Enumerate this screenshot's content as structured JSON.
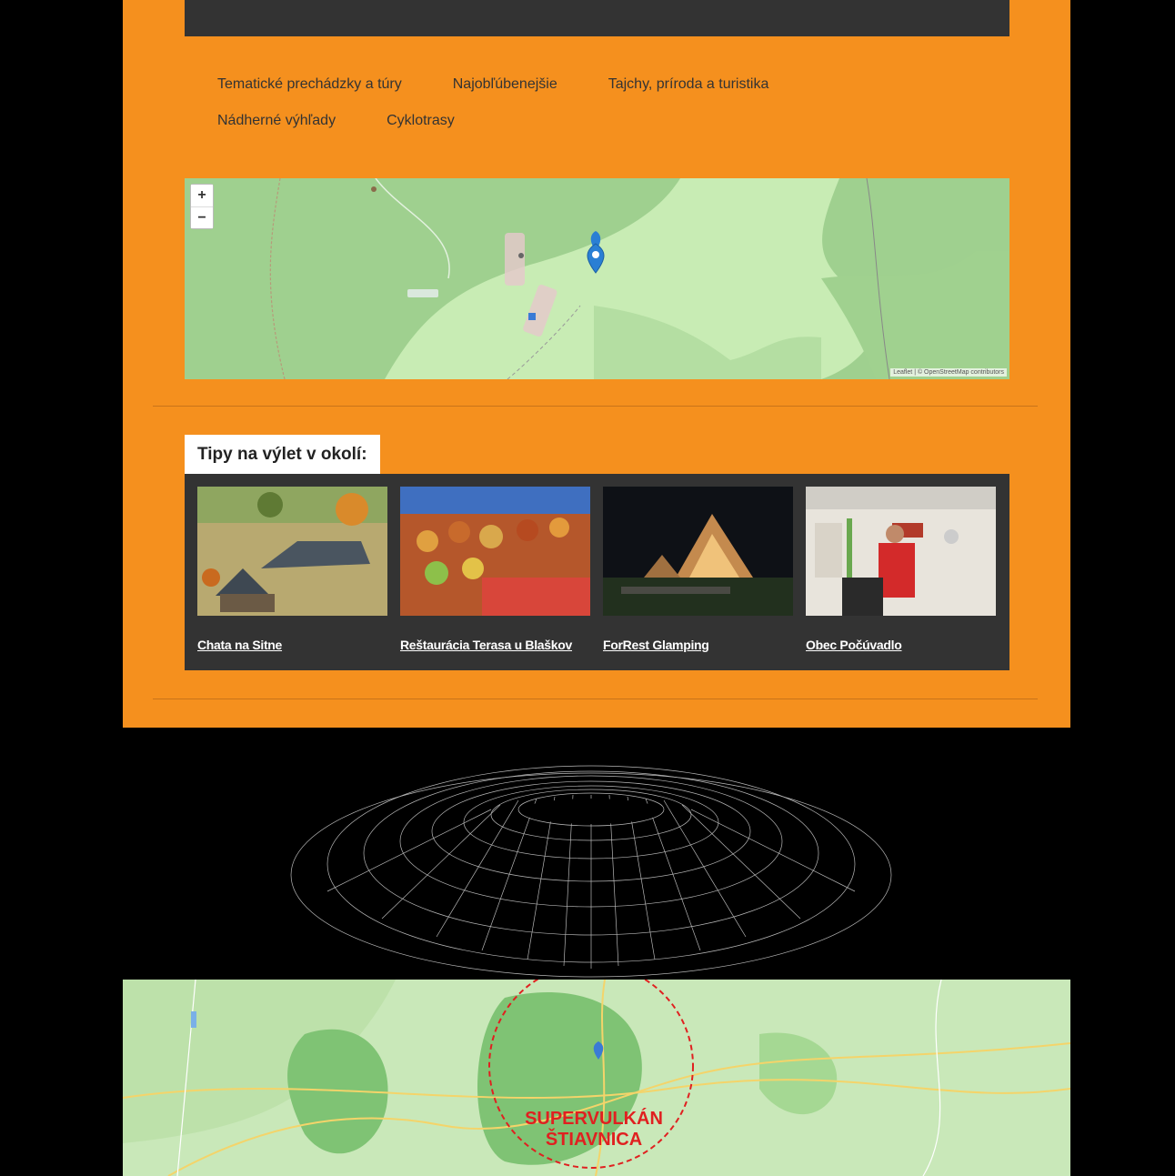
{
  "categories": [
    "Tematické prechádzky a túry",
    "Najobľúbenejšie",
    "Tajchy, príroda a turistika",
    "Nádherné výhľady",
    "Cyklotrasy"
  ],
  "map": {
    "zoom_in": "+",
    "zoom_out": "−",
    "attribution": "Leaflet | © OpenStreetMap contributors"
  },
  "tips": {
    "heading": "Tipy na výlet v okolí:",
    "items": [
      {
        "label": "Chata na Sitne",
        "icon": "chalet-photo"
      },
      {
        "label": "Reštaurácia Terasa u Blaškov",
        "icon": "food-photo"
      },
      {
        "label": "ForRest Glamping",
        "icon": "glamping-photo"
      },
      {
        "label": "Obec Počúvadlo",
        "icon": "village-photo"
      }
    ]
  },
  "supervolcano": {
    "label_line1": "SUPERVULKÁN",
    "label_line2": "ŠTIAVNICA"
  },
  "colors": {
    "panel": "#f5901e",
    "dark": "#333333",
    "accent_red": "#e02020"
  }
}
